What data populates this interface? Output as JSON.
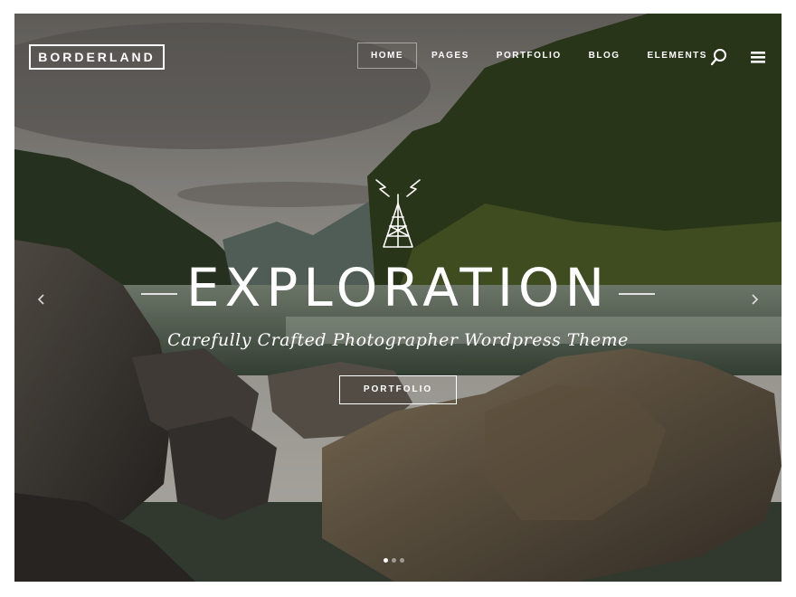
{
  "brand": {
    "logo_text": "BORDERLAND"
  },
  "nav": {
    "items": [
      {
        "label": "HOME",
        "active": true
      },
      {
        "label": "PAGES",
        "active": false
      },
      {
        "label": "PORTFOLIO",
        "active": false
      },
      {
        "label": "BLOG",
        "active": false
      },
      {
        "label": "ELEMENTS",
        "active": false
      }
    ],
    "icons": [
      "search-icon",
      "hamburger-menu-icon"
    ]
  },
  "hero": {
    "title": "EXPLORATION",
    "subtitle": "Carefully Crafted Photographer Wordpress Theme",
    "cta_label": "PORTFOLIO",
    "emblem_icon": "radio-tower-icon"
  },
  "slider": {
    "prev_icon": "chevron-left-icon",
    "next_icon": "chevron-right-icon",
    "slide_count": 3,
    "active_slide": 1
  },
  "colors": {
    "text": "#ffffff"
  }
}
